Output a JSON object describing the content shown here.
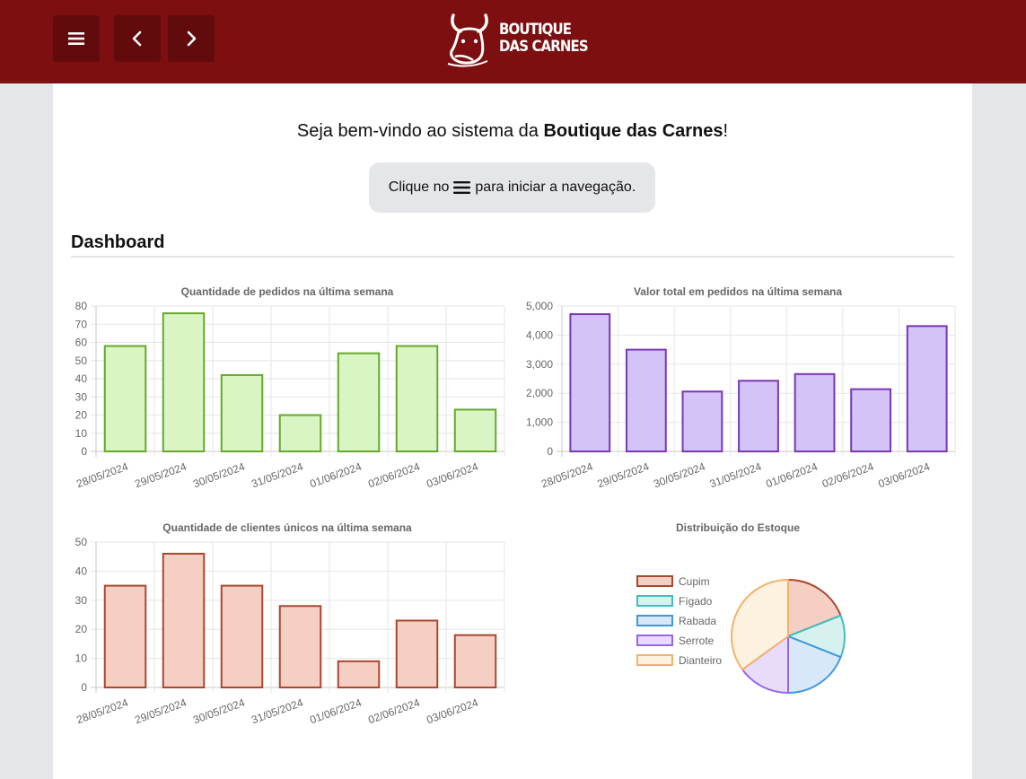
{
  "header": {
    "menu_icon": "hamburger-menu-icon",
    "back_icon": "chevron-left-icon",
    "forward_icon": "chevron-right-icon",
    "logo_line1": "BOUTIQUE",
    "logo_line2": "DAS CARNES",
    "logo_icon": "bull-head-icon",
    "background_color": "#7d0f11"
  },
  "welcome": {
    "prefix": "Seja bem-vindo ao sistema da ",
    "brand": "Boutique das Carnes",
    "suffix": "!"
  },
  "hint": {
    "before": "Clique no",
    "icon": "hamburger-menu-icon",
    "after": "para iniciar a navegação."
  },
  "dashboard": {
    "title": "Dashboard"
  },
  "chart_data": [
    {
      "type": "bar",
      "title": "Quantidade de pedidos na última semana",
      "categories": [
        "28/05/2024",
        "29/05/2024",
        "30/05/2024",
        "31/05/2024",
        "01/06/2024",
        "02/06/2024",
        "03/06/2024"
      ],
      "values": [
        58,
        76,
        42,
        20,
        54,
        58,
        23
      ],
      "ylim": [
        0,
        80
      ],
      "yticks": [
        "0",
        "10",
        "20",
        "30",
        "40",
        "50",
        "60",
        "70",
        "80"
      ],
      "grid": true,
      "fill": "#d8f5c3",
      "stroke": "#66a82b"
    },
    {
      "type": "bar",
      "title": "Valor total em pedidos na última semana",
      "categories": [
        "28/05/2024",
        "29/05/2024",
        "30/05/2024",
        "31/05/2024",
        "01/06/2024",
        "02/06/2024",
        "03/06/2024"
      ],
      "values": [
        4720,
        3500,
        2060,
        2430,
        2660,
        2140,
        4310
      ],
      "ylim": [
        0,
        5000
      ],
      "yticks": [
        "0",
        "1,000",
        "2,000",
        "3,000",
        "4,000",
        "5,000"
      ],
      "grid": true,
      "fill": "#d4c3f6",
      "stroke": "#7b36b4"
    },
    {
      "type": "bar",
      "title": "Quantidade de clientes únicos na última semana",
      "categories": [
        "28/05/2024",
        "29/05/2024",
        "30/05/2024",
        "31/05/2024",
        "01/06/2024",
        "02/06/2024",
        "03/06/2024"
      ],
      "values": [
        35,
        46,
        35,
        28,
        9,
        23,
        18
      ],
      "ylim": [
        0,
        50
      ],
      "yticks": [
        "0",
        "10",
        "20",
        "30",
        "40",
        "50"
      ],
      "grid": true,
      "fill": "#f6cfc4",
      "stroke": "#a8482f"
    },
    {
      "type": "pie",
      "title": "Distribuição do Estoque",
      "legend_position": "left",
      "series": [
        {
          "name": "Cupim",
          "value": 19,
          "fill": "#f6cfc4",
          "stroke": "#a8482f"
        },
        {
          "name": "Fígado",
          "value": 12,
          "fill": "#d7f1ef",
          "stroke": "#43bcc0"
        },
        {
          "name": "Rabada",
          "value": 19,
          "fill": "#d8e8f8",
          "stroke": "#3d9ad9"
        },
        {
          "name": "Serrote",
          "value": 15,
          "fill": "#e9dcfa",
          "stroke": "#9766e8"
        },
        {
          "name": "Dianteiro",
          "value": 35,
          "fill": "#fdf1e0",
          "stroke": "#f2b26b"
        }
      ]
    }
  ]
}
